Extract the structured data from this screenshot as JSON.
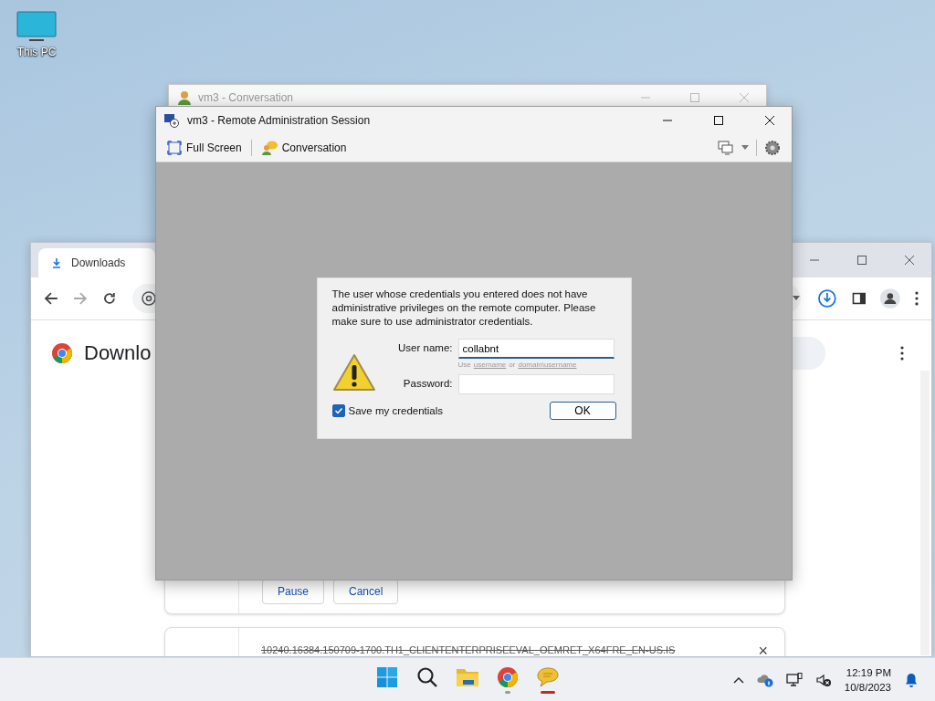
{
  "desktop": {
    "icons": [
      {
        "label": "This PC"
      }
    ]
  },
  "browser_window": {
    "tabs": [
      {
        "label": "Downloads",
        "selected": true
      }
    ],
    "page_title": "Downlo",
    "downloads": [
      {
        "kind": "active",
        "buttons": [
          "Pause",
          "Cancel"
        ]
      },
      {
        "kind": "removed",
        "filename": "10240.16384.150709-1700.TH1_CLIENTENTERPRISEEVAL_OEMRET_X64FRE_EN-US.IS",
        "close": "×"
      }
    ]
  },
  "conversation_window": {
    "title": "vm3 - Conversation",
    "active": false
  },
  "admin_window": {
    "title": "vm3 - Remote Administration Session",
    "active": true,
    "toolbar": [
      {
        "kind": "fullscreen",
        "label": "Full Screen"
      },
      {
        "kind": "conversation",
        "label": "Conversation"
      }
    ],
    "dialog": {
      "message": "The user whose credentials you entered does not have administrative privileges on the remote computer. Please make sure to use administrator credentials.",
      "username_label": "User name:",
      "username": "collabnt",
      "hint": [
        {
          "text": "Use",
          "kind": "text"
        },
        {
          "text": "username",
          "kind": "link"
        },
        {
          "text": "or",
          "kind": "text"
        },
        {
          "text": "domain\\username",
          "kind": "link"
        }
      ],
      "password_label": "Password:",
      "save_credentials": {
        "label": "Save my credentials",
        "checked": true
      },
      "ok": "OK"
    }
  },
  "taskbar": {
    "apps": [
      {
        "kind": "start"
      },
      {
        "kind": "search"
      },
      {
        "kind": "explorer"
      },
      {
        "kind": "chrome",
        "running": true,
        "selected": false
      },
      {
        "kind": "chat",
        "running": true,
        "selected": true
      }
    ],
    "time": "12:19 PM",
    "date": "10/8/2023"
  }
}
